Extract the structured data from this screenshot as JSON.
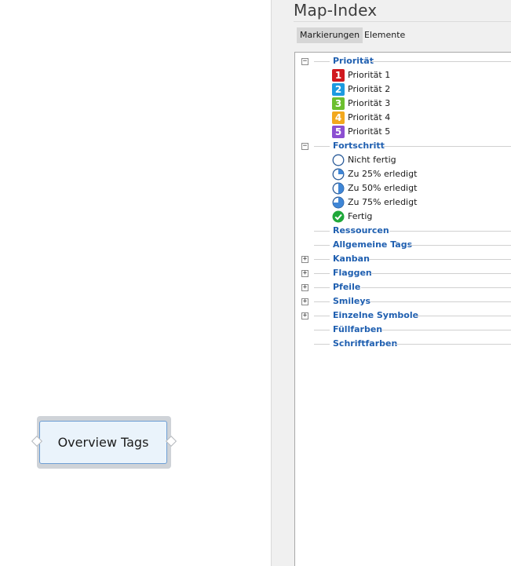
{
  "canvas": {
    "node_label": "Overview Tags"
  },
  "panel": {
    "title": "Map-Index",
    "tabs": [
      {
        "label": "Markierungen",
        "active": true
      },
      {
        "label": "Elemente",
        "active": false
      }
    ],
    "tree": {
      "prioritaet": {
        "label": "Priorität",
        "toggle": "−",
        "items": [
          {
            "label": "Priorität 1",
            "badge": "1",
            "color": "#d0191f",
            "icon": "priority-1-icon"
          },
          {
            "label": "Priorität 2",
            "badge": "2",
            "color": "#1d9be0",
            "icon": "priority-2-icon"
          },
          {
            "label": "Priorität 3",
            "badge": "3",
            "color": "#6cbf2e",
            "icon": "priority-3-icon"
          },
          {
            "label": "Priorität 4",
            "badge": "4",
            "color": "#f2a81e",
            "icon": "priority-4-icon"
          },
          {
            "label": "Priorität 5",
            "badge": "5",
            "color": "#8c4fd1",
            "icon": "priority-5-icon"
          }
        ]
      },
      "fortschritt": {
        "label": "Fortschritt",
        "toggle": "−",
        "items": [
          {
            "label": "Nicht fertig",
            "progress": 0,
            "icon": "progress-0-icon"
          },
          {
            "label": "Zu 25% erledigt",
            "progress": 25,
            "icon": "progress-25-icon"
          },
          {
            "label": "Zu 50% erledigt",
            "progress": 50,
            "icon": "progress-50-icon"
          },
          {
            "label": "Zu 75% erledigt",
            "progress": 75,
            "icon": "progress-75-icon"
          },
          {
            "label": "Fertig",
            "progress": 100,
            "icon": "check-icon"
          }
        ]
      },
      "ressourcen": {
        "label": "Ressourcen"
      },
      "allgemeine_tags": {
        "label": "Allgemeine Tags"
      },
      "kanban": {
        "label": "Kanban",
        "toggle": "+"
      },
      "flaggen": {
        "label": "Flaggen",
        "toggle": "+"
      },
      "pfeile": {
        "label": "Pfeile",
        "toggle": "+"
      },
      "smileys": {
        "label": "Smileys",
        "toggle": "+"
      },
      "einzelne_symbole": {
        "label": "Einzelne Symbole",
        "toggle": "+"
      },
      "fuellfarben": {
        "label": "Füllfarben"
      },
      "schriftfarben": {
        "label": "Schriftfarben"
      }
    }
  },
  "colors": {
    "category_text": "#1f5fb0",
    "progress_fill": "#3f86d6",
    "check_green": "#1fa83a"
  }
}
